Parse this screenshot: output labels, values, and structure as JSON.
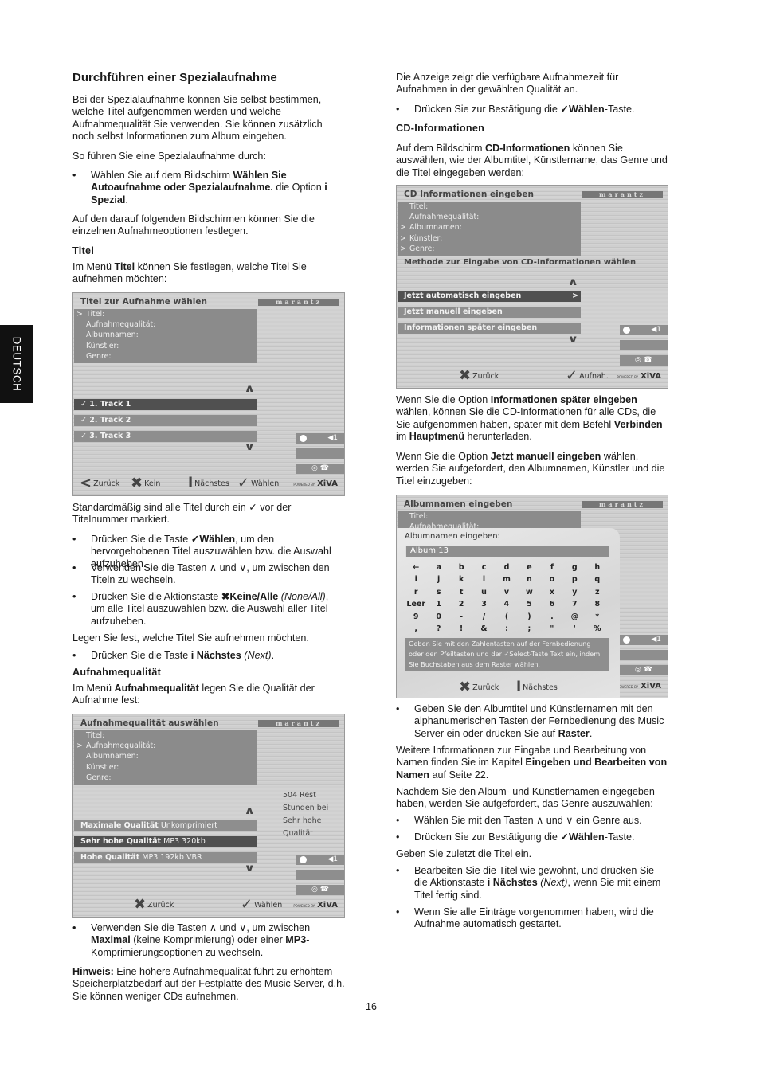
{
  "side_tab": "DEUTSCH",
  "page_number": "16",
  "left": {
    "heading": "Durchführen einer Spezialaufnahme",
    "p1": [
      [
        "Bei der Spezialaufnahme können Sie selbst bestimmen, welche Titel aufgenommen werden und welche Aufnahmequalität Sie verwenden. Sie können zusätzlich noch selbst Informationen zum Album eingeben.",
        ""
      ]
    ],
    "p2": [
      [
        "So führen Sie eine Spezialaufnahme durch:",
        ""
      ]
    ],
    "b1": [
      [
        "Wählen Sie auf dem Bildschirm ",
        ""
      ],
      [
        "Wählen Sie Autoaufnahme oder Spezialaufnahme.",
        "b"
      ],
      [
        " die Option ",
        ""
      ],
      [
        "i Spezial",
        "b"
      ],
      [
        ".",
        ""
      ]
    ],
    "p3": [
      [
        "Auf den darauf folgenden Bildschirmen können Sie die einzelnen Aufnahmeoptionen festlegen.",
        ""
      ]
    ],
    "sub_titel": "Titel",
    "p4": [
      [
        "Im Menü ",
        ""
      ],
      [
        "Titel",
        "b"
      ],
      [
        " können Sie festlegen, welche Titel Sie aufnehmen möchten:",
        ""
      ]
    ],
    "p5": [
      [
        "Standardmäßig sind alle Titel durch ein ✓ vor der Titelnummer markiert.",
        ""
      ]
    ],
    "b2": [
      [
        "Drücken Sie die Taste ",
        ""
      ],
      [
        "✓Wählen",
        "b"
      ],
      [
        ", um den hervorgehobenen Titel auszuwählen bzw. die Auswahl aufzuheben.",
        ""
      ]
    ],
    "b3": [
      [
        "Verwenden Sie die Tasten ∧ und ∨, um zwischen den Titeln zu wechseln.",
        ""
      ]
    ],
    "b4": [
      [
        "Drücken Sie die Aktionstaste ",
        ""
      ],
      [
        "✖Keine/Alle",
        "b"
      ],
      [
        " ",
        ""
      ],
      [
        "(None/All)",
        "i"
      ],
      [
        ", um alle Titel auszuwählen bzw. die Auswahl aller Titel aufzuheben.",
        ""
      ]
    ],
    "p6": [
      [
        "Legen Sie fest, welche Titel Sie aufnehmen möchten.",
        ""
      ]
    ],
    "b5": [
      [
        "Drücken Sie die Taste ",
        ""
      ],
      [
        "i Nächstes",
        "b"
      ],
      [
        " ",
        ""
      ],
      [
        "(Next)",
        "i"
      ],
      [
        ".",
        ""
      ]
    ],
    "sub_quality": "Aufnahmequalität",
    "p7": [
      [
        "Im Menü ",
        ""
      ],
      [
        "Aufnahmequalität",
        "b"
      ],
      [
        " legen Sie die Qualität der Aufnahme fest:",
        ""
      ]
    ],
    "b6": [
      [
        "Verwenden Sie die Tasten ∧ und ∨, um zwischen ",
        ""
      ],
      [
        "Maximal",
        "b"
      ],
      [
        " (keine Komprimierung) oder einer ",
        ""
      ],
      [
        "MP3",
        "b"
      ],
      [
        "-Komprimierungsoptionen zu wechseln.",
        ""
      ]
    ],
    "p8": [
      [
        "Hinweis:",
        "b"
      ],
      [
        " Eine höhere Aufnahmequalität führt zu erhöhtem Speicherplatzbedarf auf der Festplatte des Music Server, d.h. Sie können weniger CDs aufnehmen.",
        ""
      ]
    ]
  },
  "right": {
    "p1": [
      [
        "Die Anzeige zeigt die verfügbare Aufnahmezeit für Aufnahmen in der gewählten Qualität an.",
        ""
      ]
    ],
    "b1": [
      [
        "Drücken Sie zur Bestätigung die ",
        ""
      ],
      [
        "✓Wählen",
        "b"
      ],
      [
        "-Taste.",
        ""
      ]
    ],
    "sub_cd": "CD-Informationen",
    "p2": [
      [
        "Auf dem Bildschirm ",
        ""
      ],
      [
        "CD-Informationen",
        "b"
      ],
      [
        " können Sie auswählen, wie der Albumtitel, Künstlername, das Genre und die Titel eingegeben werden:",
        ""
      ]
    ],
    "p3": [
      [
        "Wenn Sie die Option ",
        ""
      ],
      [
        "Informationen später eingeben",
        "b"
      ],
      [
        " wählen, können Sie die CD-Informationen für alle CDs, die Sie aufgenommen haben, später mit dem Befehl ",
        ""
      ],
      [
        "Verbinden",
        "b"
      ],
      [
        " im ",
        ""
      ],
      [
        "Hauptmenü",
        "b"
      ],
      [
        " herunterladen.",
        ""
      ]
    ],
    "p4": [
      [
        "Wenn Sie die Option ",
        ""
      ],
      [
        "Jetzt manuell eingeben",
        "b"
      ],
      [
        " wählen, werden Sie aufgefordert, den Albumnamen, Künstler und die Titel einzugeben:",
        ""
      ]
    ],
    "b2": [
      [
        "Geben Sie den Albumtitel und Künstlernamen mit den alphanumerischen Tasten der Fernbedienung des Music Server ein oder drücken Sie auf ",
        ""
      ],
      [
        "Raster",
        "b"
      ],
      [
        ".",
        ""
      ]
    ],
    "p5": [
      [
        "Weitere Informationen zur Eingabe und Bearbeitung von Namen finden Sie im Kapitel ",
        ""
      ],
      [
        "Eingeben und Bearbeiten von Namen",
        "b"
      ],
      [
        " auf Seite 22.",
        ""
      ]
    ],
    "p6": [
      [
        "Nachdem Sie den Album- und Künstlernamen eingegeben haben, werden Sie aufgefordert, das Genre auszuwählen:",
        ""
      ]
    ],
    "b3": [
      [
        "Wählen Sie mit den Tasten ∧ und ∨ ein Genre aus.",
        ""
      ]
    ],
    "b4": [
      [
        "Drücken Sie zur Bestätigung die ",
        ""
      ],
      [
        "✓Wählen",
        "b"
      ],
      [
        "-Taste.",
        ""
      ]
    ],
    "p7": [
      [
        "Geben Sie zuletzt die Titel ein.",
        ""
      ]
    ],
    "b5": [
      [
        "Bearbeiten Sie die Titel wie gewohnt, und drücken Sie die Aktionstaste ",
        ""
      ],
      [
        "i Nächstes",
        "b"
      ],
      [
        " ",
        ""
      ],
      [
        "(Next)",
        "i"
      ],
      [
        ", wenn Sie mit einem Titel fertig sind.",
        ""
      ]
    ],
    "b6": [
      [
        "Wenn Sie alle Einträge vorgenommen haben, wird die Aufnahme automatisch gestartet.",
        ""
      ]
    ]
  },
  "screens": {
    "logo": "marantz",
    "xiva": "XiVA",
    "xiva_small": "POWERED BY",
    "volume": "◀1",
    "info_items": [
      "Titel:",
      "Aufnahmequalität:",
      "Albumnamen:",
      "Künstler:",
      "Genre:"
    ],
    "titel": {
      "title": "Titel zur Aufnahme wählen",
      "rows": [
        "✓ 1. Track 1",
        "✓ 2. Track 2",
        "✓ 3. Track 3"
      ],
      "footer": [
        {
          "icon": "<",
          "label": "Zurück"
        },
        {
          "icon": "✖",
          "label": "Kein"
        },
        {
          "icon": "i",
          "label": "Nächstes"
        },
        {
          "icon": "✓",
          "label": "Wählen"
        }
      ]
    },
    "quality": {
      "title": "Aufnahmequalität auswählen",
      "rows": [
        {
          "b": "Maximale Qualität",
          "n": " Unkomprimiert"
        },
        {
          "b": "Sehr hohe Qualität",
          "n": " MP3 320kb"
        },
        {
          "b": "Hohe Qualität",
          "n": " MP3 192kb VBR"
        }
      ],
      "side": [
        "504 Rest",
        "Stunden bei",
        "Sehr hohe",
        "Qualität"
      ],
      "footer": [
        {
          "icon": "✖",
          "label": "Zurück"
        },
        {
          "icon": "✓",
          "label": "Wählen"
        }
      ]
    },
    "cdinfo": {
      "title": "CD Informationen eingeben",
      "method": "Methode zur Eingabe von CD-Informationen wählen",
      "rows": [
        "Jetzt automatisch eingeben",
        "Jetzt manuell eingeben",
        "Informationen später eingeben"
      ],
      "footer": [
        {
          "icon": "✖",
          "label": "Zurück"
        },
        {
          "icon": "✓",
          "label": "Aufnah."
        }
      ]
    },
    "album": {
      "title": "Albumnamen eingeben",
      "dialog_label": "Albumnamen eingeben:",
      "input_value": "Album 13",
      "grid": [
        "←",
        "a",
        "b",
        "c",
        "d",
        "e",
        "f",
        "g",
        "h",
        "i",
        "j",
        "k",
        "l",
        "m",
        "n",
        "o",
        "p",
        "q",
        "r",
        "s",
        "t",
        "u",
        "v",
        "w",
        "x",
        "y",
        "z",
        "Leer",
        "1",
        "2",
        "3",
        "4",
        "5",
        "6",
        "7",
        "8",
        "9",
        "0",
        "-",
        "/",
        "(",
        ")",
        ".",
        "@",
        "*",
        ",",
        "?",
        "!",
        "&",
        ":",
        ";",
        "\"",
        "'",
        "%"
      ],
      "help": "Geben Sie mit den Zahlentasten auf der Fernbedienung oder den Pfeiltasten und der ✓Select-Taste Text ein, indem Sie Buchstaben aus dem Raster wählen.",
      "footer": [
        {
          "icon": "✖",
          "label": "Zurück"
        },
        {
          "icon": "i",
          "label": "Nächstes"
        }
      ]
    }
  }
}
